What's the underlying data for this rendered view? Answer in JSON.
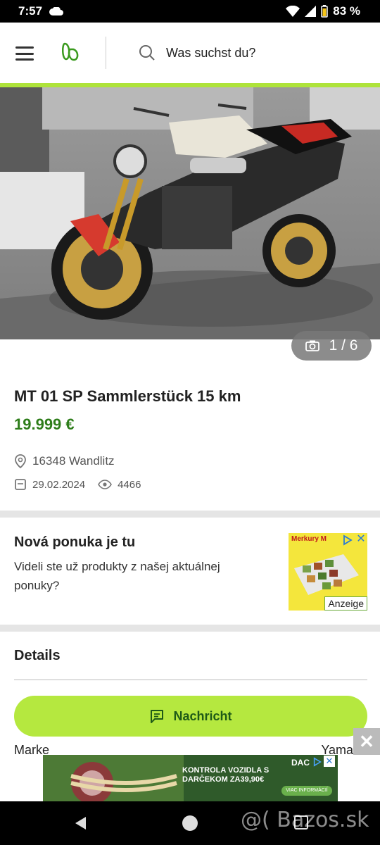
{
  "status_bar": {
    "time": "7:57",
    "battery": "83 %"
  },
  "header": {
    "search_placeholder": "Was suchst du?"
  },
  "gallery": {
    "counter": "1 / 6"
  },
  "listing": {
    "title": "MT 01 SP Sammlerstück 15 km",
    "price": "19.999 €",
    "location": "16348 Wandlitz",
    "date": "29.02.2024",
    "views": "4466"
  },
  "ad": {
    "title": "Nová ponuka je tu",
    "text": "Videli ste už produkty z našej aktuálnej ponuky?",
    "brand": "Merkury M",
    "label": "Anzeige"
  },
  "details": {
    "title": "Details",
    "rows": [
      {
        "label": "Marke",
        "value": "Yama"
      }
    ]
  },
  "actions": {
    "message_label": "Nachricht"
  },
  "banner": {
    "text": "KONTROLA VOZIDLA S DARČEKOM ZA39,90€",
    "brand": "DAC",
    "cta": "VIAC INFORMÁCIÍ"
  },
  "watermark": "@( Bazos.sk",
  "colors": {
    "accent": "#aee33a",
    "price": "#2e7d1a",
    "button": "#b5e83f"
  }
}
